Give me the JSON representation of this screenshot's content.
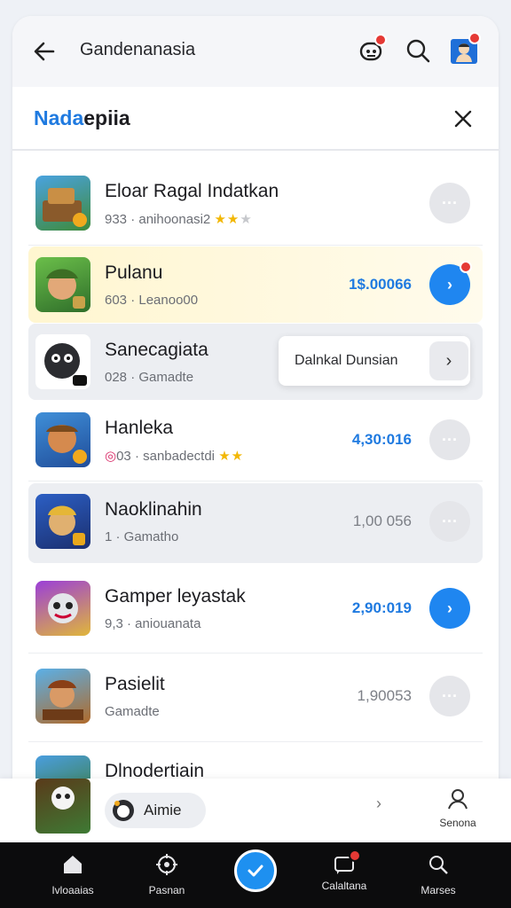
{
  "topbar": {
    "title": "Gandenanasia"
  },
  "subheader": {
    "title_accent": "Nada",
    "title_rest": "epiia"
  },
  "rows": [
    {
      "name": "Eloar Ragal Indatkan",
      "meta": "933 · anihoonasi2",
      "stars": "★★",
      "stars_off": "★",
      "price": "",
      "action": "···"
    },
    {
      "name": "Pulanu",
      "meta": "603 · Leanoo00",
      "stars": "",
      "stars_off": "",
      "price": "1$.00066",
      "action": "›"
    },
    {
      "name": "Sanecagiata",
      "meta": "028 · Gamadte",
      "stars": "",
      "stars_off": "",
      "price": "",
      "action": ""
    },
    {
      "name": "Hanleka",
      "meta": "03 · sanbadectdi",
      "stars": "★★",
      "stars_off": "",
      "price": "4,30:016",
      "action": "···"
    },
    {
      "name": "Naoklinahin",
      "meta": "1 · Gamatho",
      "stars": "",
      "stars_off": "",
      "price": "1,00 056",
      "action": "···"
    },
    {
      "name": "Gamper leyastak",
      "meta": "9,3 · aniouanata",
      "stars": "",
      "stars_off": "",
      "price": "2,90:019",
      "action": "›"
    },
    {
      "name": "Pasielit",
      "meta": "Gamadte",
      "stars": "",
      "stars_off": "",
      "price": "1,90053",
      "action": "···"
    },
    {
      "name": "Dlnodertiain",
      "meta": "",
      "stars": "",
      "stars_off": "",
      "price": "",
      "action": ""
    }
  ],
  "popup": {
    "label": "Dalnkal Dunsian",
    "arrow": "›"
  },
  "bottom_panel": {
    "chip_label": "Aimie",
    "chevron": "›",
    "side_label": "Senona"
  },
  "nav": {
    "items": [
      {
        "label": "Ivloaaias"
      },
      {
        "label": "Pasnan"
      },
      {
        "label": "Calaltana"
      },
      {
        "label": "Marses"
      }
    ]
  },
  "colors": {
    "accent": "#1f7ae0",
    "highlight": "#fff8dc",
    "badge": "#e53935",
    "navbar": "#0c0c0d"
  },
  "icons": [
    "back-arrow-icon",
    "robot-icon",
    "search-icon",
    "avatar-icon",
    "close-icon",
    "home-icon",
    "settings-icon",
    "check-icon",
    "chat-icon"
  ]
}
